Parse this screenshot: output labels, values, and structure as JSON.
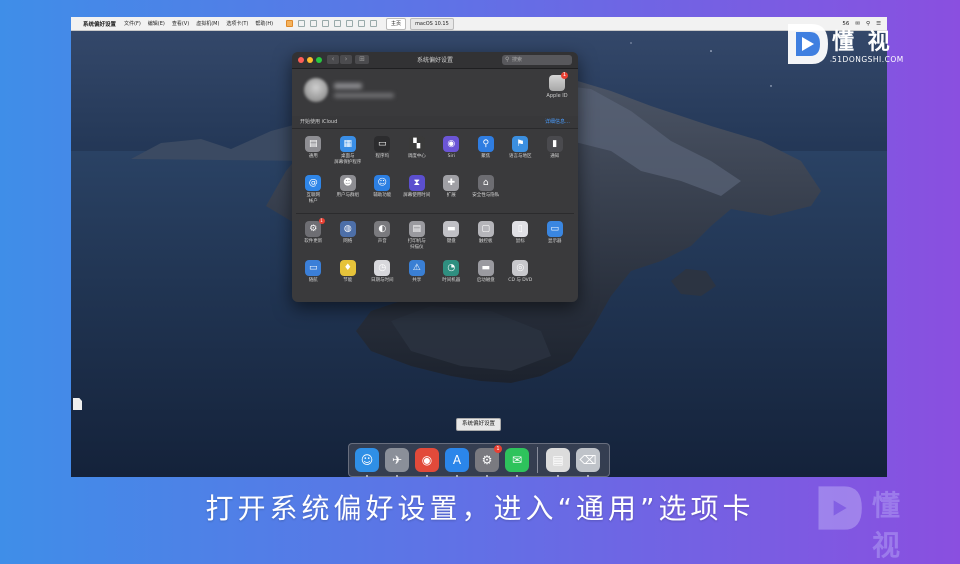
{
  "vm_bar": {
    "active_app": "系统偏好设置",
    "menus": [
      "文件(F)",
      "编辑(E)",
      "查看(V)",
      "虚拟机(M)",
      "选项卡(T)",
      "帮助(H)"
    ],
    "tabs": [
      {
        "label": "主页",
        "active": false
      },
      {
        "label": "macOS 10.15",
        "active": true
      }
    ],
    "right_items": [
      "56",
      "✉",
      "⚲",
      "☰"
    ]
  },
  "prefs_window": {
    "title": "系统偏好设置",
    "search_placeholder": "搜索",
    "nav_back": "‹",
    "nav_forward": "›",
    "grid_button": "⊞",
    "apple_id_label": "Apple ID",
    "apple_id_badge": "1",
    "icloud_hint": "开始使用 iCloud",
    "icloud_link": "详细信息…",
    "rows": [
      [
        {
          "label": "通用",
          "icon": "general-icon",
          "glyph": "▤",
          "color": "#8e8e93"
        },
        {
          "label": "桌面与\n屏幕保护程序",
          "icon": "desktop-screensaver-icon",
          "glyph": "▦",
          "color": "#3a8ee6"
        },
        {
          "label": "程序坞",
          "icon": "dock-icon",
          "glyph": "▭",
          "color": "#2c2c2e"
        },
        {
          "label": "调度中心",
          "icon": "mission-control-icon",
          "glyph": "▚",
          "color": "#3a3a3a"
        },
        {
          "label": "Siri",
          "icon": "siri-icon",
          "glyph": "◉",
          "color": "#6b55d6"
        },
        {
          "label": "聚焦",
          "icon": "spotlight-icon",
          "glyph": "⚲",
          "color": "#2f7de1"
        },
        {
          "label": "语言与地区",
          "icon": "language-region-icon",
          "glyph": "⚑",
          "color": "#3b8fe0"
        },
        {
          "label": "通知",
          "icon": "notifications-icon",
          "glyph": "▮",
          "color": "#4a4a4e"
        }
      ],
      [
        {
          "label": "互联网\n帐户",
          "icon": "internet-accounts-icon",
          "glyph": "@",
          "color": "#2f86e8"
        },
        {
          "label": "用户与群组",
          "icon": "users-groups-icon",
          "glyph": "☻",
          "color": "#8e8e93"
        },
        {
          "label": "辅助功能",
          "icon": "accessibility-icon",
          "glyph": "☺",
          "color": "#2c7fe3"
        },
        {
          "label": "屏幕使用时间",
          "icon": "screen-time-icon",
          "glyph": "⧗",
          "color": "#5b4fcf"
        },
        {
          "label": "扩展",
          "icon": "extensions-icon",
          "glyph": "✚",
          "color": "#a0a0a5"
        },
        {
          "label": "安全性与隐私",
          "icon": "security-privacy-icon",
          "glyph": "⌂",
          "color": "#6d6d72"
        }
      ],
      [
        {
          "label": "软件更新",
          "icon": "software-update-icon",
          "glyph": "⚙",
          "color": "#6e6e73",
          "badge": "1"
        },
        {
          "label": "网络",
          "icon": "network-icon",
          "glyph": "◍",
          "color": "#4d6fa8"
        },
        {
          "label": "声音",
          "icon": "sound-icon",
          "glyph": "◐",
          "color": "#7a7a7e"
        },
        {
          "label": "打印机与\n扫描仪",
          "icon": "printers-scanners-icon",
          "glyph": "▤",
          "color": "#9a9a9f"
        },
        {
          "label": "键盘",
          "icon": "keyboard-icon",
          "glyph": "▬",
          "color": "#c0c0c5"
        },
        {
          "label": "触控板",
          "icon": "trackpad-icon",
          "glyph": "▢",
          "color": "#b5b5ba"
        },
        {
          "label": "鼠标",
          "icon": "mouse-icon",
          "glyph": "▯",
          "color": "#e0e0e5"
        },
        {
          "label": "显示器",
          "icon": "displays-icon",
          "glyph": "▭",
          "color": "#3a86e0"
        }
      ],
      [
        {
          "label": "随航",
          "icon": "sidecar-icon",
          "glyph": "▭",
          "color": "#3b7fd8"
        },
        {
          "label": "节能",
          "icon": "energy-saver-icon",
          "glyph": "♦",
          "color": "#e6c33a"
        },
        {
          "label": "日期与时间",
          "icon": "date-time-icon",
          "glyph": "◷",
          "color": "#d8d8dc"
        },
        {
          "label": "共享",
          "icon": "sharing-icon",
          "glyph": "⚠",
          "color": "#3a7fd4"
        },
        {
          "label": "时间机器",
          "icon": "time-machine-icon",
          "glyph": "◔",
          "color": "#2f8f80"
        },
        {
          "label": "启动磁盘",
          "icon": "startup-disk-icon",
          "glyph": "▬",
          "color": "#9a9aa0"
        },
        {
          "label": "CD 与 DVD",
          "icon": "cd-dvd-icon",
          "glyph": "◎",
          "color": "#c8c8cc"
        }
      ]
    ]
  },
  "tooltip": "系统偏好设置",
  "dock": {
    "apps": [
      {
        "name": "finder",
        "glyph": "☺",
        "color": "#2f8fe6"
      },
      {
        "name": "launchpad",
        "glyph": "✈",
        "color": "#8a8f99"
      },
      {
        "name": "chrome",
        "glyph": "◉",
        "color": "#e24a3a"
      },
      {
        "name": "app-store",
        "glyph": "A",
        "color": "#2b86ea"
      },
      {
        "name": "system-preferences",
        "glyph": "⚙",
        "color": "#7a7a80",
        "badge": "1"
      },
      {
        "name": "wechat",
        "glyph": "✉",
        "color": "#2ec35c"
      }
    ],
    "trailing": [
      {
        "name": "document",
        "glyph": "▤",
        "color": "#dcdcdc"
      },
      {
        "name": "trash",
        "glyph": "⌫",
        "color": "#bfc3c9"
      }
    ]
  },
  "brand": {
    "name": "懂 视",
    "site": "51DONGSHI.COM",
    "accent": "#4fd2ff"
  },
  "subtitle": "打开系统偏好设置，进入“通用”选项卡"
}
